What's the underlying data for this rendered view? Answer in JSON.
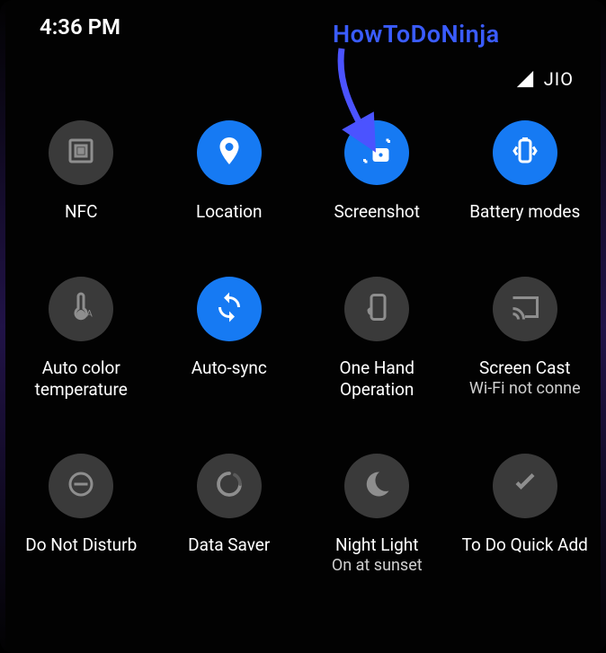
{
  "status": {
    "time": "4:36 PM",
    "carrier": "JIO"
  },
  "overlay": {
    "watermark": "HowToDoNinja",
    "watermark_color": "#3a5cff"
  },
  "tiles": [
    {
      "id": "nfc",
      "label": "NFC",
      "sub": "",
      "on": false,
      "icon": "nfc-icon"
    },
    {
      "id": "location",
      "label": "Location",
      "sub": "",
      "on": true,
      "icon": "location-icon"
    },
    {
      "id": "screenshot",
      "label": "Screenshot",
      "sub": "",
      "on": true,
      "icon": "screenshot-icon"
    },
    {
      "id": "battery-modes",
      "label": "Battery modes",
      "sub": "",
      "on": true,
      "icon": "battery-icon"
    },
    {
      "id": "auto-color-temp",
      "label": "Auto color temperature",
      "sub": "",
      "on": false,
      "icon": "thermometer-icon"
    },
    {
      "id": "auto-sync",
      "label": "Auto-sync",
      "sub": "",
      "on": true,
      "icon": "sync-icon"
    },
    {
      "id": "one-hand",
      "label": "One Hand Operation",
      "sub": "",
      "on": false,
      "icon": "one-hand-icon"
    },
    {
      "id": "screen-cast",
      "label": "Screen Cast",
      "sub": "Wi-Fi not conne",
      "on": false,
      "icon": "cast-icon"
    },
    {
      "id": "dnd",
      "label": "Do Not Disturb",
      "sub": "",
      "on": false,
      "icon": "dnd-icon"
    },
    {
      "id": "data-saver",
      "label": "Data Saver",
      "sub": "",
      "on": false,
      "icon": "data-saver-icon"
    },
    {
      "id": "night-light",
      "label": "Night Light",
      "sub": "On at sunset",
      "on": false,
      "icon": "moon-icon"
    },
    {
      "id": "todo-quick-add",
      "label": "To Do Quick Add",
      "sub": "",
      "on": false,
      "icon": "check-icon"
    }
  ]
}
